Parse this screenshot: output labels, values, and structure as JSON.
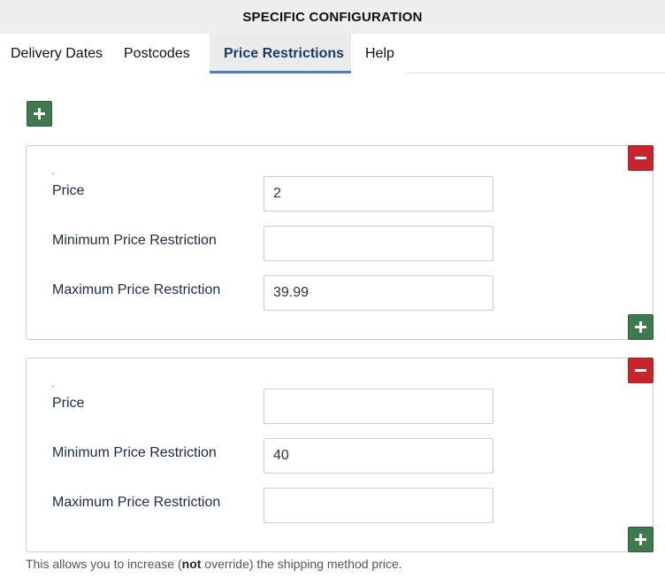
{
  "header": {
    "title": "SPECIFIC CONFIGURATION"
  },
  "tabs": [
    {
      "label": "Delivery Dates"
    },
    {
      "label": "Postcodes"
    },
    {
      "label": "Price Restrictions"
    },
    {
      "label": "Help"
    }
  ],
  "active_tab": "Price Restrictions",
  "icons": {
    "add": "plus-icon",
    "remove": "minus-icon"
  },
  "colors": {
    "add": "#3f7a4e",
    "remove": "#c8242b",
    "tab_accent": "#4a7ec8"
  },
  "rows": [
    {
      "price_label": "Price",
      "price_value": "2",
      "min_label": "Minimum Price Restriction",
      "min_value": "",
      "max_label": "Maximum Price Restriction",
      "max_value": "39.99"
    },
    {
      "price_label": "Price",
      "price_value": "",
      "min_label": "Minimum Price Restriction",
      "min_value": "40",
      "max_label": "Maximum Price Restriction",
      "max_value": ""
    }
  ],
  "footer": {
    "before": "This allows you to increase (",
    "emphasis": "not",
    "after": " override) the shipping method price."
  }
}
